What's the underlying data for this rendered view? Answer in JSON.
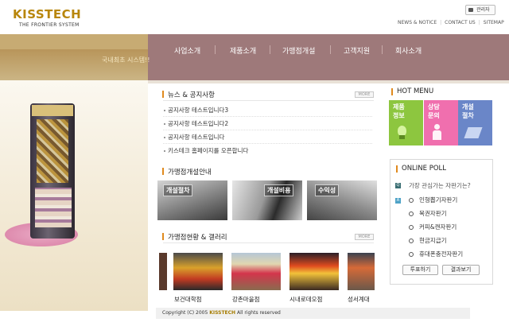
{
  "header": {
    "logo_text": "KISSTECH",
    "logo_subtitle": "THE FRONTIER SYSTEM",
    "admin_button": "관리자",
    "links": [
      "NEWS & NOTICE",
      "CONTACT US",
      "SITEMAP"
    ]
  },
  "nav": {
    "items": [
      "사업소개",
      "제품소개",
      "가맹점개설",
      "고객지원",
      "회사소개"
    ],
    "slogan": "국내최초 시스템!!"
  },
  "news": {
    "title": "뉴스 & 공지사항",
    "more": "MORE",
    "items": [
      "공지사항 테스트입니다3",
      "공지사항 테스트입니다2",
      "공지사항 테스트입니다",
      "키스테크 홈페이지를 오픈합니다"
    ]
  },
  "franchise": {
    "title": "가맹점개설안내",
    "banners": [
      "개설절차",
      "개설비용",
      "수익성"
    ]
  },
  "gallery": {
    "title": "가맹점현황 & 갤러리",
    "more": "MORE",
    "captions": [
      "보건대학점",
      "강촌마을점",
      "시내로데오점",
      "성서계대"
    ]
  },
  "hot_menu": {
    "title": "HOT MENU",
    "tiles": [
      {
        "line1": "제품",
        "line2": "정보",
        "color": "#8dc63f"
      },
      {
        "line1": "상담",
        "line2": "문의",
        "color": "#f06fae"
      },
      {
        "line1": "개설",
        "line2": "절차",
        "color": "#6a86c8"
      }
    ]
  },
  "poll": {
    "title": "ONLINE POLL",
    "question": "가장 관심가는 자판기는?",
    "options": [
      "인형뽑기자판기",
      "복권자판기",
      "커피&캔자판기",
      "현금지급기",
      "휴대폰충전자판기"
    ],
    "vote_button": "투표하기",
    "result_button": "결과보기"
  },
  "footer": {
    "text": "Copyright (C) 2005",
    "brand": "KISSTECH",
    "rights": "All rights reserved"
  },
  "colors": {
    "nav_band": "#9e797a",
    "band_gold": "#c7ab73",
    "accent": "#e08a1e"
  }
}
